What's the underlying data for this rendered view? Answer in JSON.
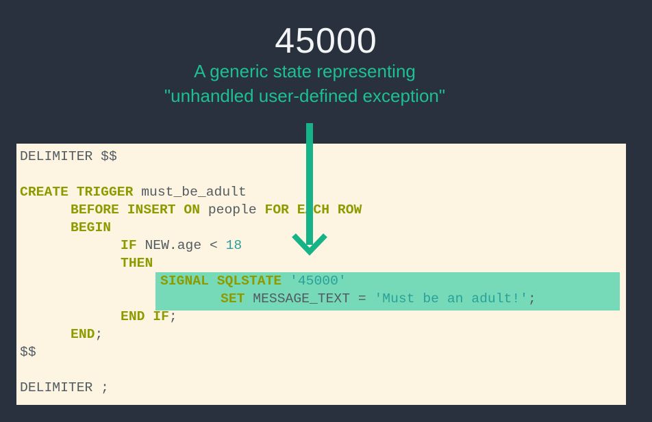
{
  "headline": "45000",
  "caption": {
    "line1": "A generic state representing",
    "line2": "\"unhandled user-defined exception\""
  },
  "colors": {
    "background": "#28313d",
    "code_panel": "#fdf5e1",
    "accent": "#1ebf93",
    "highlight": "#76dab9",
    "keyword": "#8e9b00",
    "literal": "#2aa198"
  },
  "code": {
    "l1": {
      "a": "DELIMITER $$"
    },
    "l3": {
      "a": "CREATE TRIGGER",
      "b": " must_be_adult"
    },
    "l4": {
      "a": "BEFORE INSERT ON",
      "b": " people ",
      "c": "FOR EACH ROW"
    },
    "l5": {
      "a": "BEGIN"
    },
    "l6": {
      "a": "IF",
      "b": " NEW.age < ",
      "c": "18"
    },
    "l7": {
      "a": "THEN"
    },
    "l8": {
      "a": "SIGNAL SQLSTATE",
      "b": " ",
      "c": "'45000'"
    },
    "l9": {
      "a": "SET",
      "b": " MESSAGE_TEXT = ",
      "c": "'Must be an adult!'",
      "d": ";"
    },
    "l10": {
      "a": "END IF",
      "b": ";"
    },
    "l11": {
      "a": "END",
      "b": ";"
    },
    "l12": {
      "a": "$$"
    },
    "l14": {
      "a": "DELIMITER ;"
    }
  }
}
